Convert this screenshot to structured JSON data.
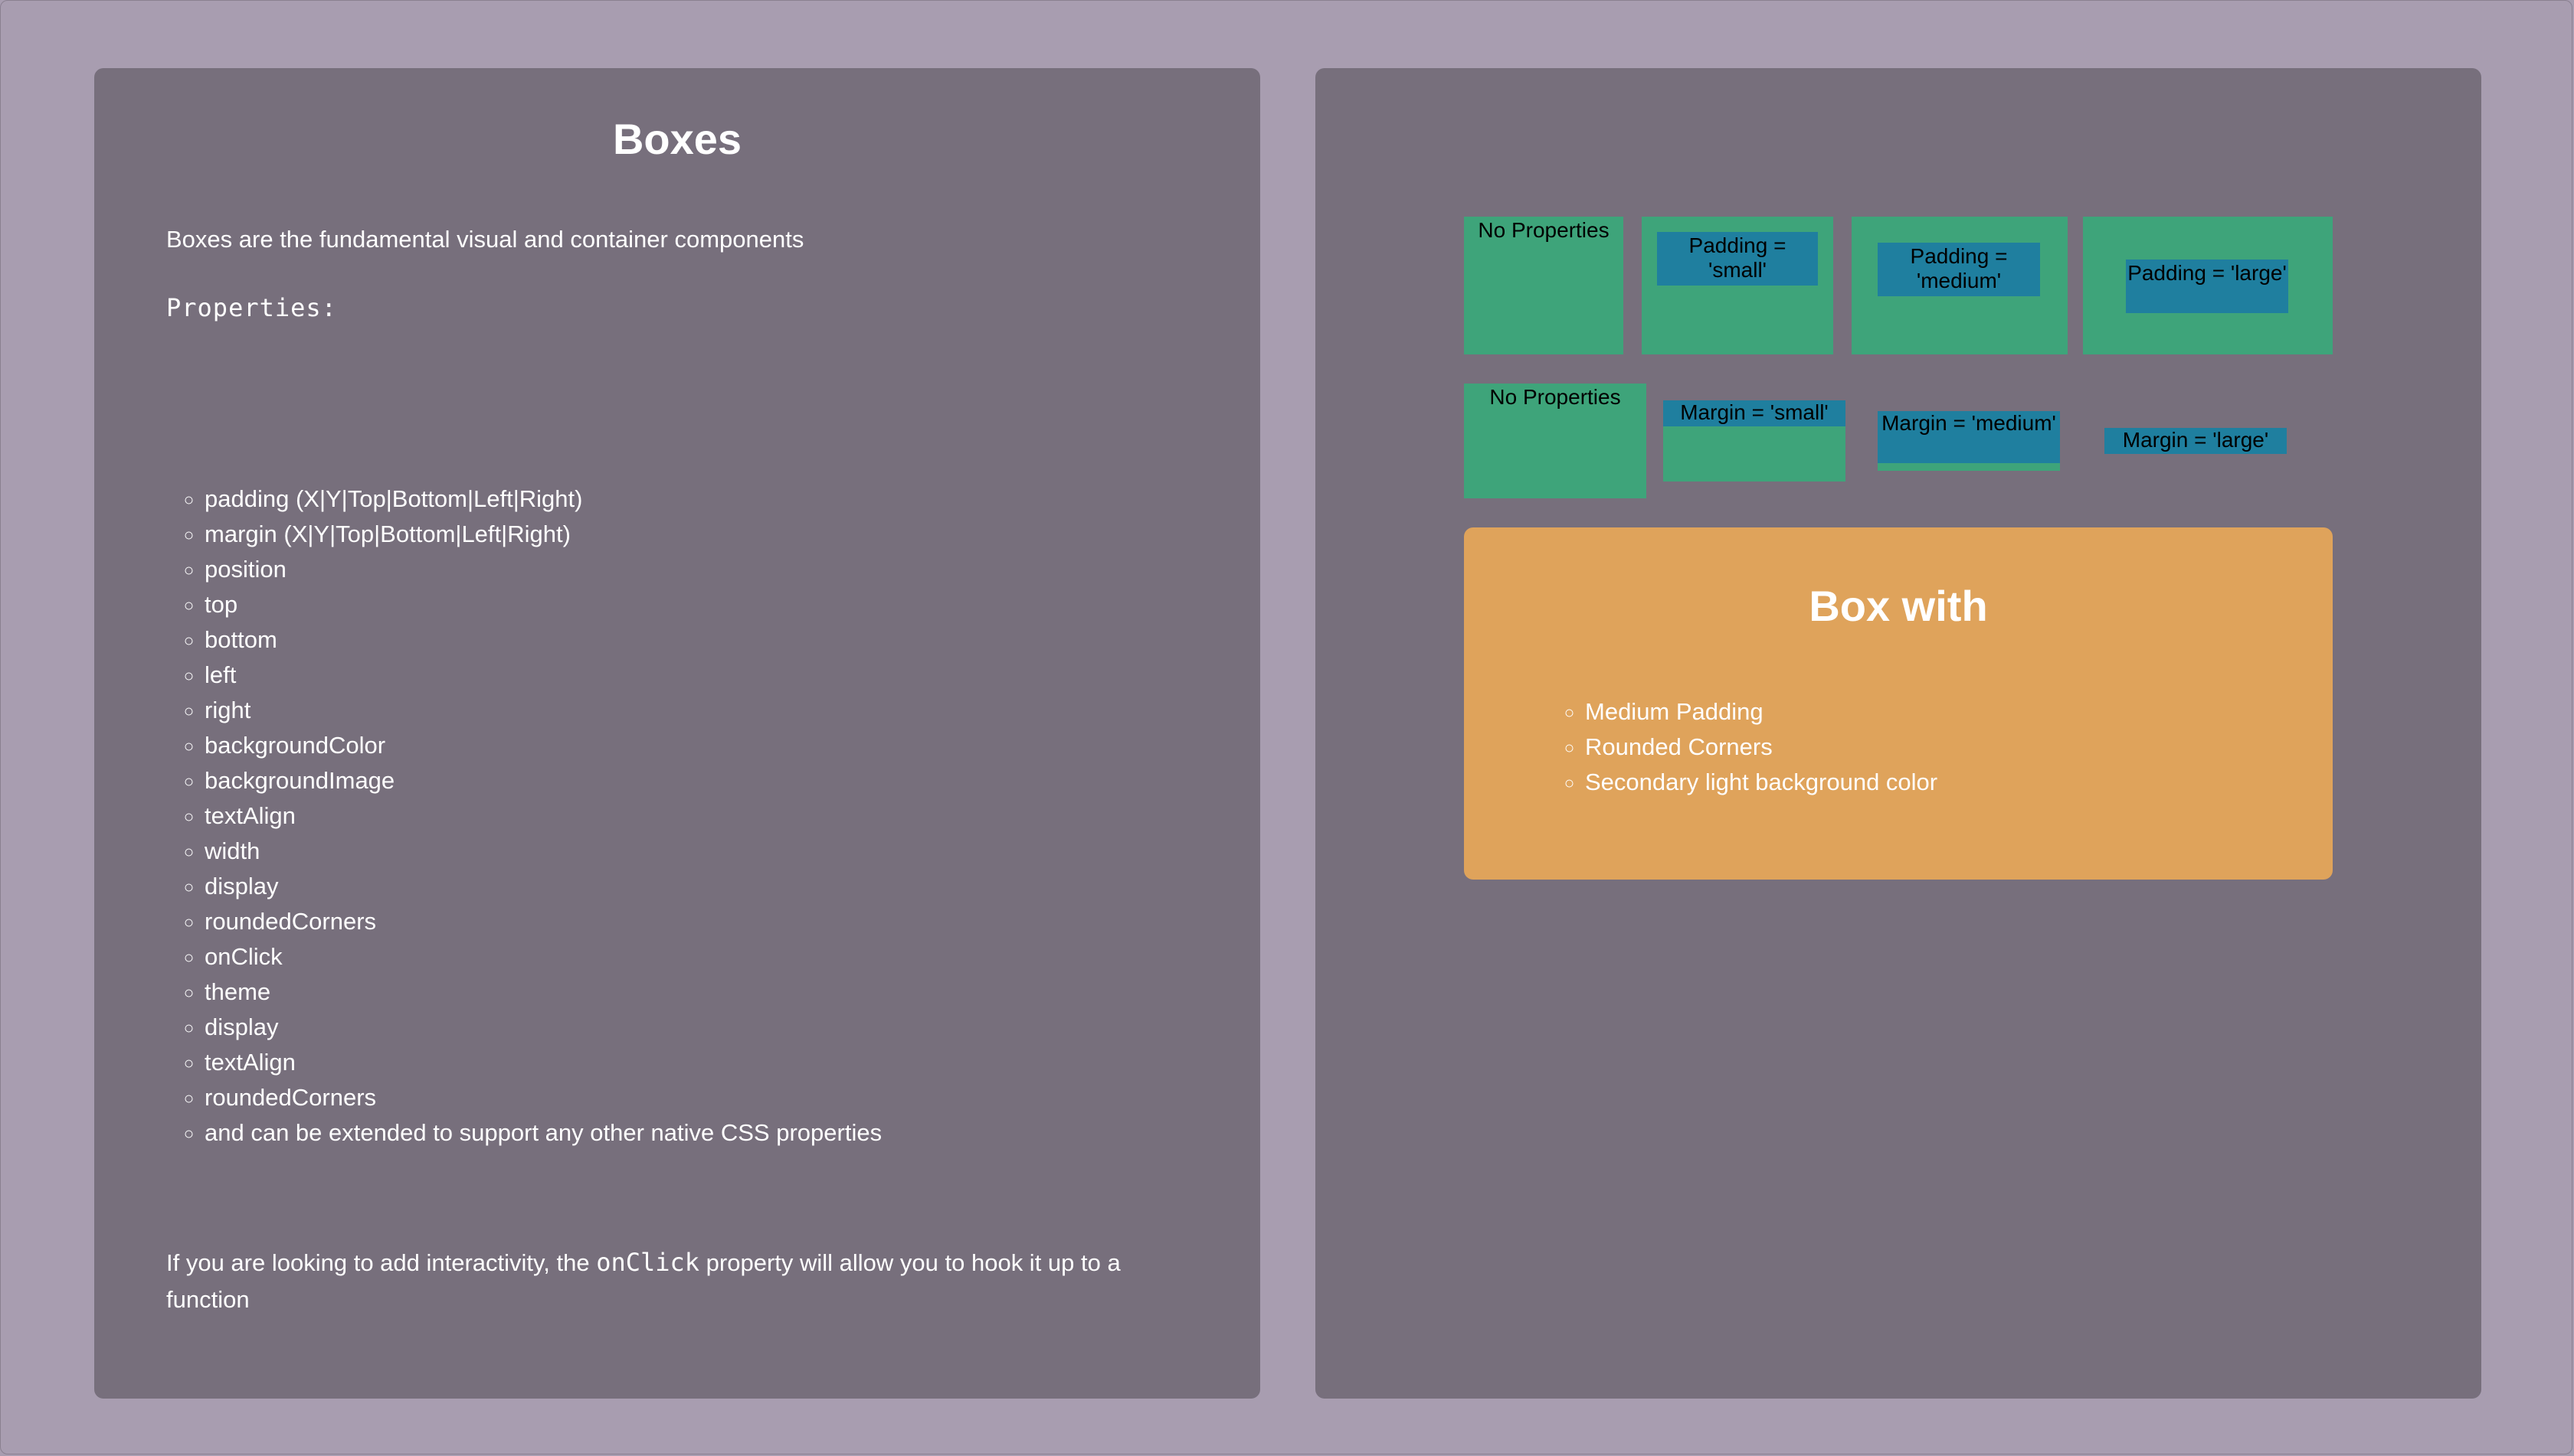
{
  "left": {
    "title": "Boxes",
    "intro": "Boxes are the fundamental visual and container components",
    "properties_heading": "Properties:",
    "properties": [
      "padding (X|Y|Top|Bottom|Left|Right)",
      "margin (X|Y|Top|Bottom|Left|Right)",
      "position",
      "top",
      "bottom",
      "left",
      "right",
      "backgroundColor",
      "backgroundImage",
      "textAlign",
      "width",
      "display",
      "roundedCorners",
      "onClick",
      "theme",
      "display",
      "textAlign",
      "roundedCorners",
      "and can be extended to support any other native CSS properties"
    ],
    "footer_before": "If you are looking to add interactivity, the ",
    "footer_code": "onClick",
    "footer_after": " property will allow you to hook it up to a function"
  },
  "right": {
    "padding_row": {
      "none": "No Properties",
      "small": "Padding = 'small'",
      "medium": "Padding = 'medium'",
      "large": "Padding = 'large'"
    },
    "margin_row": {
      "none": "No Properties",
      "small": "Margin = 'small'",
      "medium": "Margin = 'medium'",
      "large": "Margin = 'large'"
    },
    "feature_box": {
      "title": "Box with",
      "items": [
        "Medium Padding",
        "Rounded Corners",
        "Secondary light background color"
      ]
    }
  },
  "colors": {
    "page_background": "#a89db0",
    "panel_background": "#776f7c",
    "green_box": "#3ea47a",
    "blue_box": "#1f7f9f",
    "orange_box": "#dfa35b"
  }
}
